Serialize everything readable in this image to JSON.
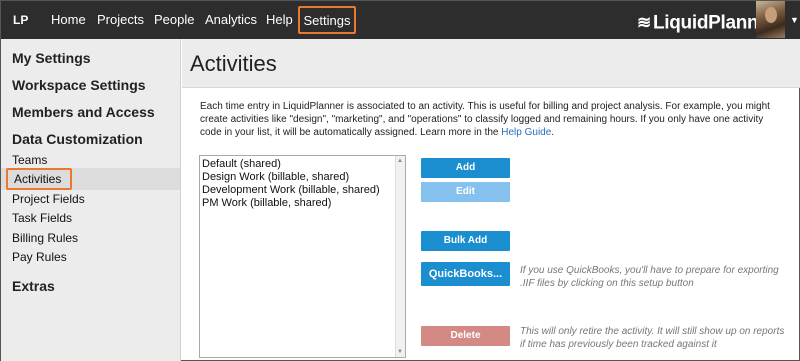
{
  "topnav": {
    "logo": "LP",
    "items": [
      "Home",
      "Projects",
      "People",
      "Analytics",
      "Help"
    ],
    "settings": "Settings",
    "brand": "LiquidPlanner",
    "brand_mark": "≋",
    "brand_reg": "®",
    "caret": "▼"
  },
  "sidebar": {
    "my_settings": "My Settings",
    "workspace_settings": "Workspace Settings",
    "members_access": "Members and Access",
    "data_customization": "Data Customization",
    "links": [
      "Teams",
      "Activities",
      "Project Fields",
      "Task Fields",
      "Billing Rules",
      "Pay Rules"
    ],
    "extras": "Extras"
  },
  "main": {
    "title": "Activities",
    "description_pre": "Each time entry in LiquidPlanner is associated to an activity. This is useful for billing and project analysis. For example, you might create activities like \"design\", \"marketing\", and \"operations\" to classify logged and remaining hours. If you only have one activity code in your list, it will be automatically assigned. Learn more in the ",
    "help_link": "Help Guide",
    "description_post": ".",
    "activities": [
      "Default (shared)",
      "Design Work (billable, shared)",
      "Development Work (billable, shared)",
      "PM Work (billable, shared)"
    ],
    "buttons": {
      "add": "Add",
      "edit": "Edit",
      "bulk_add": "Bulk Add",
      "quickbooks": "QuickBooks...",
      "delete": "Delete"
    },
    "quickbooks_note": "If you use QuickBooks, you'll have to prepare for exporting .IIF files by clicking on this setup button",
    "delete_note": "This will only retire the activity. It will still show up on reports if time has previously been tracked against it"
  }
}
